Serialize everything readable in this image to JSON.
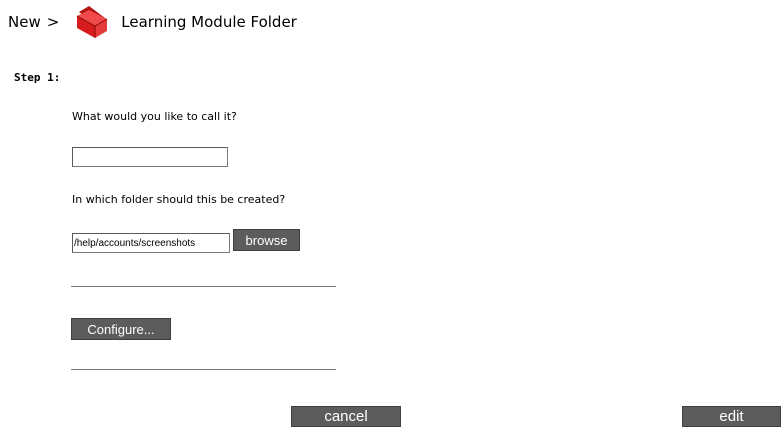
{
  "header": {
    "breadcrumb_root": "New",
    "breadcrumb_separator": ">",
    "title": "Learning Module Folder",
    "icon": "red-folder-icon"
  },
  "form": {
    "step_label": "Step 1:",
    "name_question": "What would you like to call it?",
    "name_value": "",
    "folder_question": "In which folder should this be created?",
    "folder_value": "/help/accounts/screenshots",
    "browse_label": "browse",
    "configure_label": "Configure..."
  },
  "footer": {
    "cancel_label": "cancel",
    "edit_label": "edit"
  },
  "colors": {
    "button_bg": "#5c5c5c",
    "button_text": "#ffffff",
    "folder_red": "#d01818"
  }
}
